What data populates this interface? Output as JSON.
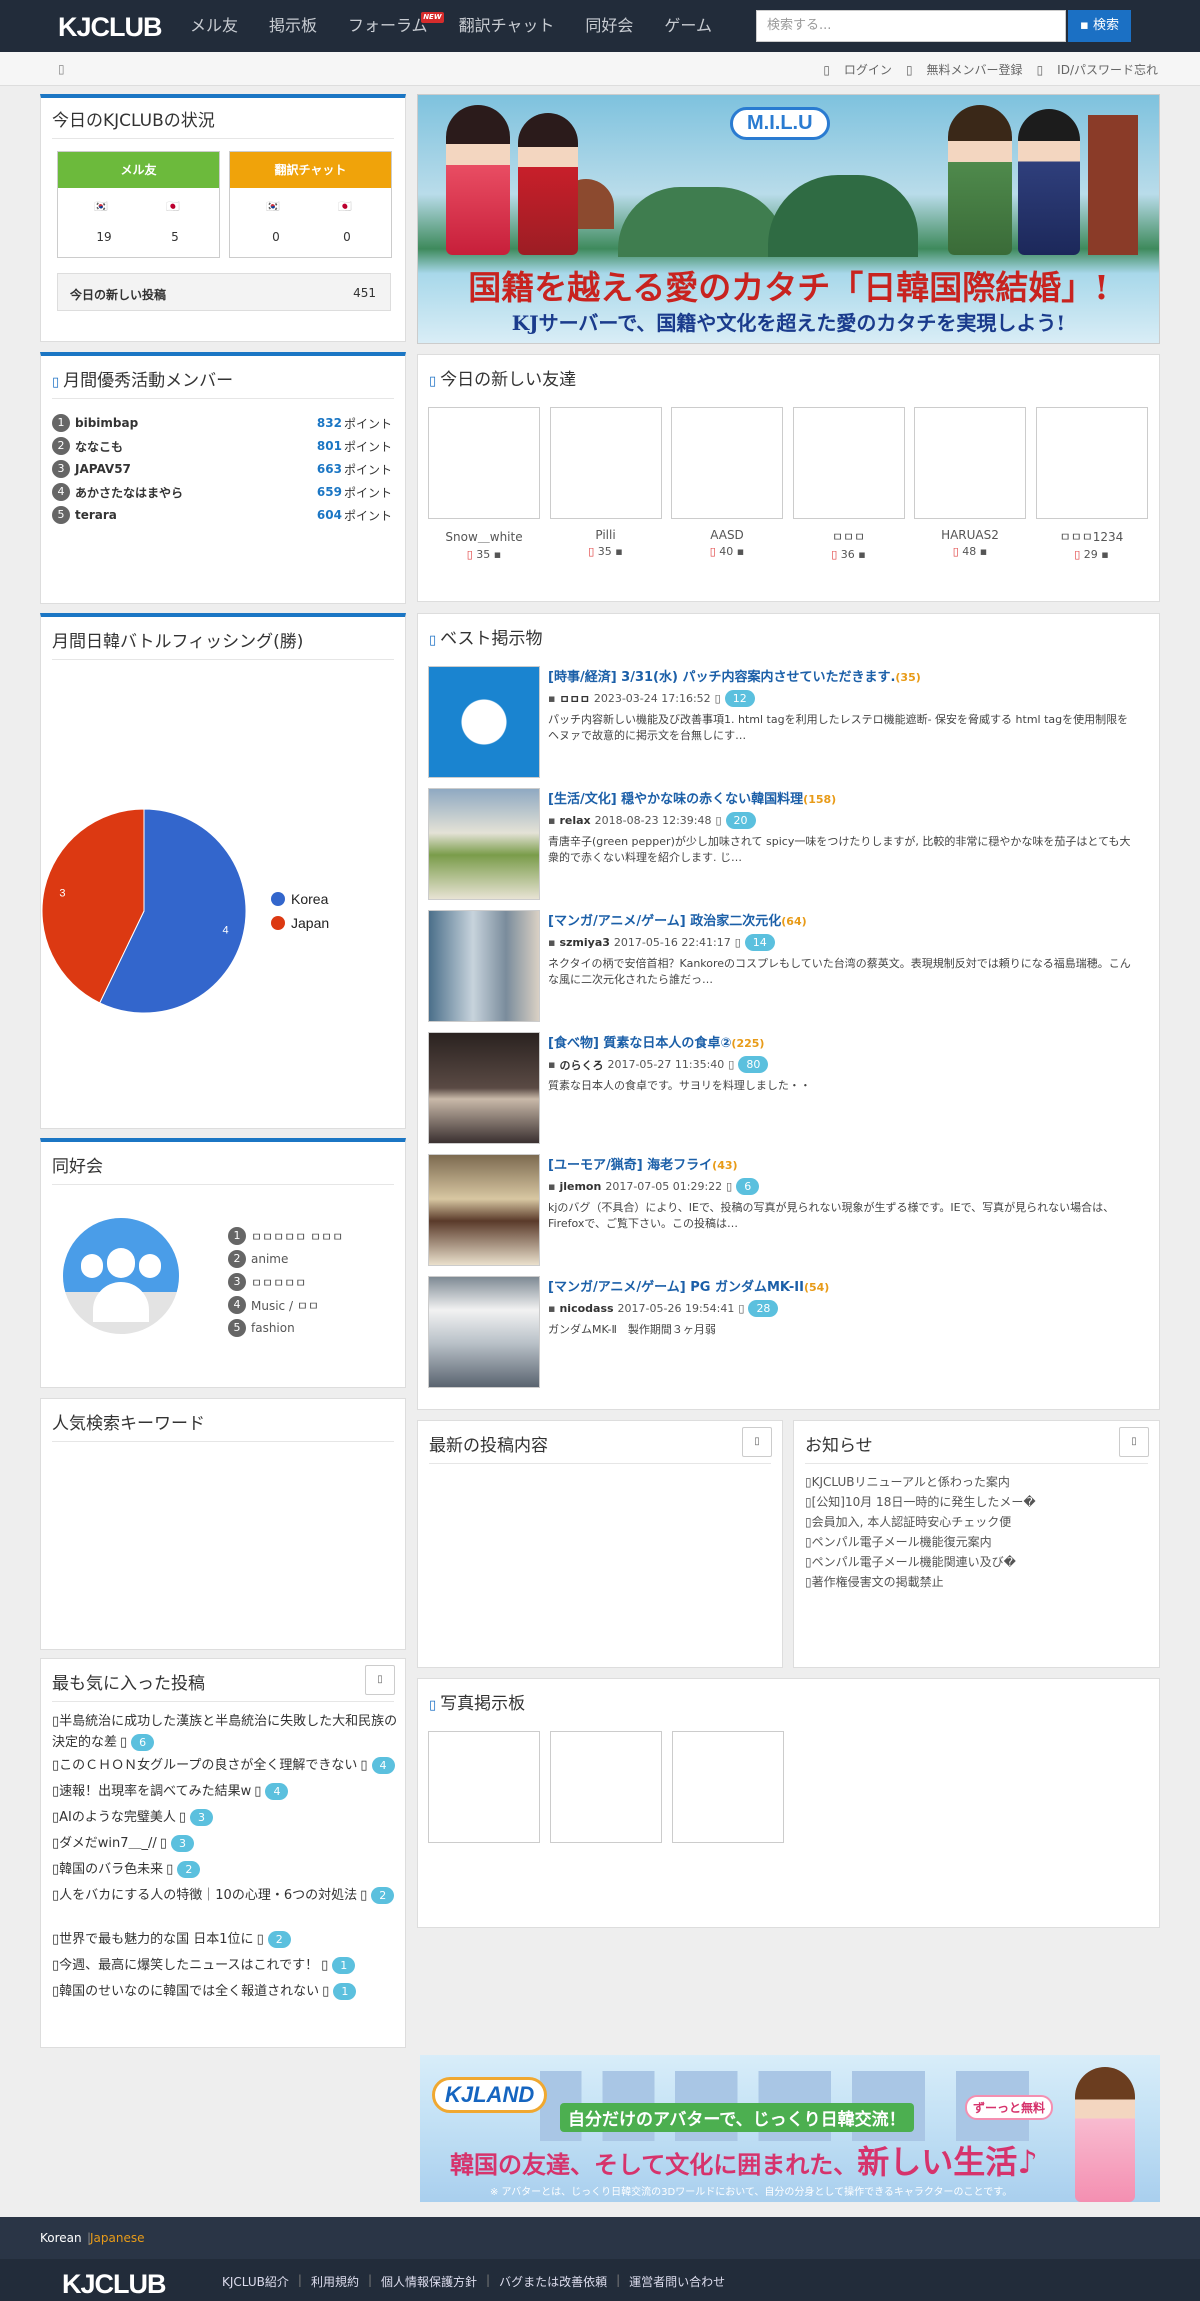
{
  "nav": {
    "logo": "KJCLUB",
    "menu": [
      "メル友",
      "掲示板",
      "フォーラム",
      "翻訳チャット",
      "同好会",
      "ゲーム"
    ],
    "new_badge": "NEW",
    "search_placeholder": "検索する...",
    "search_button": "検索"
  },
  "subbar": {
    "links": [
      "ログイン",
      "無料メンバー登録",
      "ID/パスワード忘れ"
    ]
  },
  "status": {
    "title": "今日のKJCLUBの状況",
    "mail": {
      "label": "メル友",
      "korea": "19",
      "japan": "5"
    },
    "chat": {
      "label": "翻訳チャット",
      "korea": "0",
      "japan": "0"
    },
    "today_posts_label": "今日の新しい投稿",
    "today_posts": "451",
    "colors": {
      "mail": "#6cba3c",
      "chat": "#f0a30a"
    }
  },
  "ranking": {
    "title": "月間優秀活動メンバー",
    "unit": "ポイント",
    "items": [
      {
        "n": "1",
        "name": "bibimbap",
        "points": "832"
      },
      {
        "n": "2",
        "name": "ななこも",
        "points": "801"
      },
      {
        "n": "3",
        "name": "JAPAV57",
        "points": "663"
      },
      {
        "n": "4",
        "name": "あかさたなはまやら",
        "points": "659"
      },
      {
        "n": "5",
        "name": "terara",
        "points": "604"
      }
    ]
  },
  "battle": {
    "title": "月間日韓バトルフィッシング(勝)"
  },
  "chart_data": {
    "type": "pie",
    "categories": [
      "Korea",
      "Japan"
    ],
    "values": [
      4,
      3
    ],
    "colors": [
      "#3366cc",
      "#dc3912"
    ],
    "legend": "right"
  },
  "banner": {
    "logo": "M.I.L.U",
    "line1": "国籍を越える愛のカタチ「日韓国際結婚」!",
    "line2": "KJサーバーで、国籍や文化を超えた愛のカタチを実現しよう!"
  },
  "friends": {
    "title": "今日の新しい友達",
    "items": [
      {
        "name": "Snow＿white",
        "age": "35"
      },
      {
        "name": "Pilli",
        "age": "35"
      },
      {
        "name": "AASD",
        "age": "40"
      },
      {
        "name": "ㅁㅁㅁ",
        "age": "36"
      },
      {
        "name": "HARUAS2",
        "age": "48"
      },
      {
        "name": "ㅁㅁㅁ1234",
        "age": "29"
      }
    ]
  },
  "best": {
    "title": "ベスト掲示物",
    "posts": [
      {
        "title": "[時事/経済] 3/31(水) パッチ内容案内させていただきます.",
        "count": "(35)",
        "author": "ㅁㅁㅁ",
        "date": "2023-03-24 17:16:52",
        "comments": "12",
        "desc": "パッチ内容新しい機能及び改善事項1. html tagを利用したレステロ機能遮断- 保安を脅威する html tagを使用制限をヘヌァで故意的に掲示文を台無しにす…"
      },
      {
        "title": "[生活/文化] 穏やかな味の赤くない韓国料理",
        "count": "(158)",
        "author": "relax",
        "date": "2018-08-23 12:39:48",
        "comments": "20",
        "desc": "青唐辛子(green pepper)が少し加味されて spicy一味をつけたりしますが, 比較的非常に穏やかな味を茄子はとても大衆的で赤くない料理を紹介します. じ…"
      },
      {
        "title": "[マンガ/アニメ/ゲーム] 政治家二次元化",
        "count": "(64)",
        "author": "szmiya3",
        "date": "2017-05-16 22:41:17",
        "comments": "14",
        "desc": "ネクタイの柄で安倍首相？Kankoreのコスプレもしていた台湾の蔡英文。表現規制反対では頼りになる福島瑞穂。こんな風に二次元化されたら誰だっ…"
      },
      {
        "title": "[食べ物] 質素な日本人の食卓②",
        "count": "(225)",
        "author": "のらくろ",
        "date": "2017-05-27 11:35:40",
        "comments": "80",
        "desc": "質素な日本人の食卓です。サヨリを料理しました・・"
      },
      {
        "title": "[ユーモア/猟奇] 海老フライ",
        "count": "(43)",
        "author": "jlemon",
        "date": "2017-07-05 01:29:22",
        "comments": "6",
        "desc": "kjのバグ（不具合）により、IEで、投稿の写真が見られない現象が生ずる様です。IEで、写真が見られない場合は、Firefoxで、ご覧下さい。この投稿は…"
      },
      {
        "title": "[マンガ/アニメ/ゲーム] PG ガンダムMK-II",
        "count": "(54)",
        "author": "nicodass",
        "date": "2017-05-26 19:54:41",
        "comments": "28",
        "desc": "ガンダムMK-Ⅱ　製作期間３ヶ月弱"
      }
    ]
  },
  "clubs": {
    "title": "同好会",
    "items": [
      {
        "n": "1",
        "name": "ㅁㅁㅁㅁㅁ ㅁㅁㅁ"
      },
      {
        "n": "2",
        "name": "anime"
      },
      {
        "n": "3",
        "name": "ㅁㅁㅁㅁㅁ"
      },
      {
        "n": "4",
        "name": "Music / ㅁㅁ"
      },
      {
        "n": "5",
        "name": "fashion"
      }
    ]
  },
  "keywords": {
    "title": "人気検索キーワード"
  },
  "latest": {
    "title": "最新の投稿内容"
  },
  "notice": {
    "title": "お知らせ",
    "items": [
      "KJCLUBリニューアルと係わった案内",
      "[公知]10月 18日一時的に発生したメー�",
      "会員加入, 本人認証時安心チェック便",
      "ペンパル電子メール機能復元案内",
      "ペンパル電子メール機能関連い及び�",
      "著作権侵害文の掲載禁止"
    ]
  },
  "favorites": {
    "title": "最も気に入った投稿",
    "items": [
      {
        "title": "半島統治に成功した漢族と半島統治に失敗した大和民族の決定的な差",
        "c": "6"
      },
      {
        "title": "このＣＨＯＮ女グループの良さが全く理解できない",
        "c": "4"
      },
      {
        "title": "速報！出現率を調べてみた結果w",
        "c": "4"
      },
      {
        "title": "AIのような完璧美人",
        "c": "3"
      },
      {
        "title": "ダメだwin7＿_//",
        "c": "3"
      },
      {
        "title": "韓国のバラ色未来",
        "c": "2"
      },
      {
        "title": "人をバカにする人の特徴｜10の心理・6つの対処法",
        "c": "2"
      },
      {
        "title": "世界で最も魅力的な国 日本1位に",
        "c": "2"
      },
      {
        "title": "今週、最高に爆笑したニュースはこれです！",
        "c": "1"
      },
      {
        "title": "韓国のせいなのに韓国では全く報道されない",
        "c": "1"
      }
    ]
  },
  "photo": {
    "title": "写真掲示板"
  },
  "ad": {
    "logo": "KJLAND",
    "line1": "自分だけのアバターで、じっくり日韓交流！",
    "tag": "ずーっと無料",
    "line2a": "韓国の友達、そして文化に囲まれた、",
    "line2b": "新しい生活♪",
    "note": "※ アバターとは、じっくり日韓交流の3Dワールドにおいて、自分の分身として操作できるキャラクターのことです。"
  },
  "footer": {
    "lang_korean": "Korean",
    "lang_japanese": "Japanese",
    "logo": "KJCLUB",
    "links": [
      "KJCLUB紹介",
      "利用規約",
      "個人情報保護方針",
      "バグまたは改善依頼",
      "運営者問い合わせ"
    ]
  }
}
